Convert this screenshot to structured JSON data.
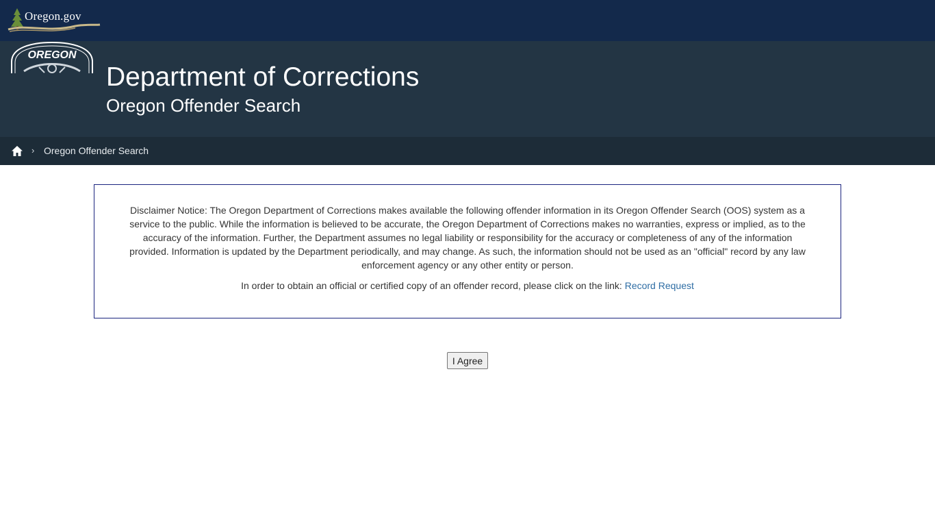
{
  "topbar": {
    "logo_text": "Oregon.gov",
    "logo_icon": "tree-river-icon"
  },
  "banner": {
    "seal_text": "OREGON",
    "seal_icon": "oregon-state-seal-icon",
    "title": "Department of Corrections",
    "subtitle": "Oregon Offender Search"
  },
  "breadcrumb": {
    "home_icon": "home-icon",
    "separator": "›",
    "current": "Oregon Offender Search"
  },
  "disclaimer": {
    "paragraph1": "Disclaimer Notice: The Oregon Department of Corrections makes available the following offender information in its Oregon Offender Search (OOS) system as a service to the public. While the information is believed to be accurate, the Oregon Department of Corrections makes no warranties, express or implied, as to the accuracy of the information. Further, the Department assumes no legal liability or responsibility for the accuracy or completeness of any of the information provided. Information is updated by the Department periodically, and may change. As such, the information should not be used as an \"official\" record by any law enforcement agency or any other entity or person.",
    "paragraph2_prefix": "In order to obtain an official or certified copy of an offender record, please click on the link: ",
    "link_label": "Record Request"
  },
  "agree_button": "I Agree",
  "colors": {
    "topbar": "#13294b",
    "banner": "#233544",
    "breadcrumb": "#1d2c38",
    "link": "#2e6da4",
    "border": "#1a237e"
  }
}
